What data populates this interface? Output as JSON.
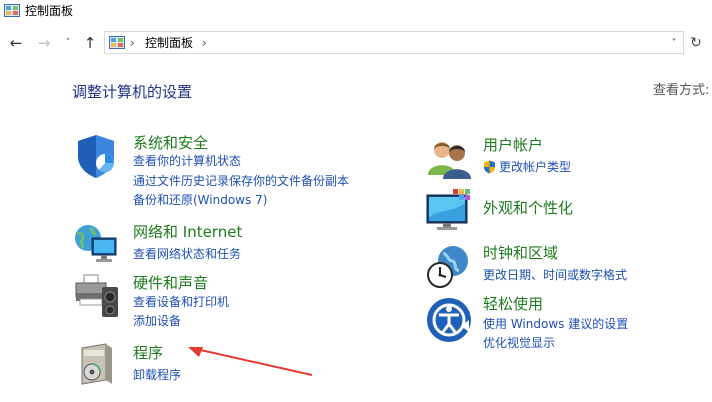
{
  "window": {
    "title": "控制面板"
  },
  "nav": {
    "back": "←",
    "forward": "→",
    "recent": "˅",
    "up": "↑",
    "address_sep1": "›",
    "address_text": "控制面板",
    "address_sep2": "›",
    "dropdown": "˅",
    "refresh": "↻"
  },
  "main": {
    "title": "调整计算机的设置",
    "view_by": "查看方式:"
  },
  "left_categories": [
    {
      "title": "系统和安全",
      "links": [
        "查看你的计算机状态",
        "通过文件历史记录保存你的文件备份副本",
        "备份和还原(Windows 7)"
      ]
    },
    {
      "title": "网络和 Internet",
      "links": [
        "查看网络状态和任务"
      ]
    },
    {
      "title": "硬件和声音",
      "links": [
        "查看设备和打印机",
        "添加设备"
      ]
    },
    {
      "title": "程序",
      "links": [
        "卸载程序"
      ]
    }
  ],
  "right_categories": [
    {
      "title": "用户帐户",
      "links": [
        "更改帐户类型"
      ]
    },
    {
      "title": "外观和个性化",
      "links": []
    },
    {
      "title": "时钟和区域",
      "links": [
        "更改日期、时间或数字格式"
      ]
    },
    {
      "title": "轻松使用",
      "links": [
        "使用 Windows 建议的设置",
        "优化视觉显示"
      ]
    }
  ],
  "colors": {
    "category_title": "#1e7c1e",
    "link": "#1f4fb4",
    "page_title": "#1e3287",
    "annotation_arrow": "#e53a2f"
  }
}
